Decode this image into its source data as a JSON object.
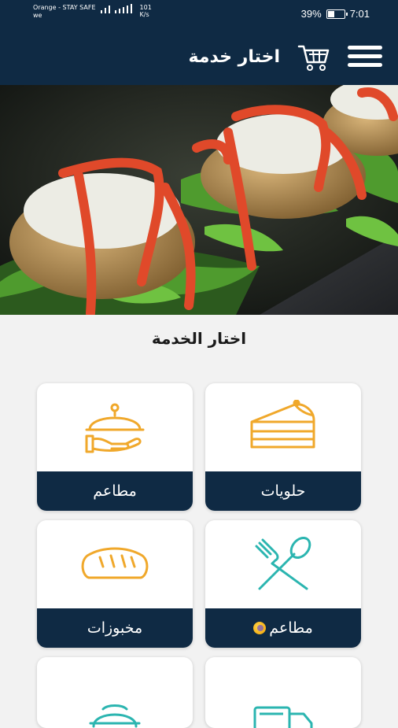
{
  "status_bar": {
    "carrier_line1": "Orange - STAY SAFE",
    "carrier_line2": "we",
    "speed_top": "101",
    "speed_bottom": "K/s",
    "battery": "39%",
    "time": "7:01"
  },
  "app_bar": {
    "title": "اختار خدمة",
    "menu_icon": "hamburger-menu-icon",
    "cart_icon": "cart-icon"
  },
  "hero": {
    "image": "stuffed-mushrooms-photo"
  },
  "section": {
    "title": "اختار الخدمة"
  },
  "services": [
    {
      "label": "حلويات",
      "icon": "cake-slice-icon"
    },
    {
      "label": "مطاعم",
      "icon": "serving-cloche-icon"
    },
    {
      "label": "مطاعم",
      "icon": "fork-spoon-icon"
    },
    {
      "label": "مخبوزات",
      "icon": "bread-loaf-icon"
    },
    {
      "label": "",
      "icon": "delivery-van-icon"
    },
    {
      "label": "",
      "icon": "cloche-icon"
    }
  ],
  "colors": {
    "primary": "#0f2a44",
    "icon_orange": "#f0a82b",
    "icon_teal": "#2bb5b0"
  }
}
